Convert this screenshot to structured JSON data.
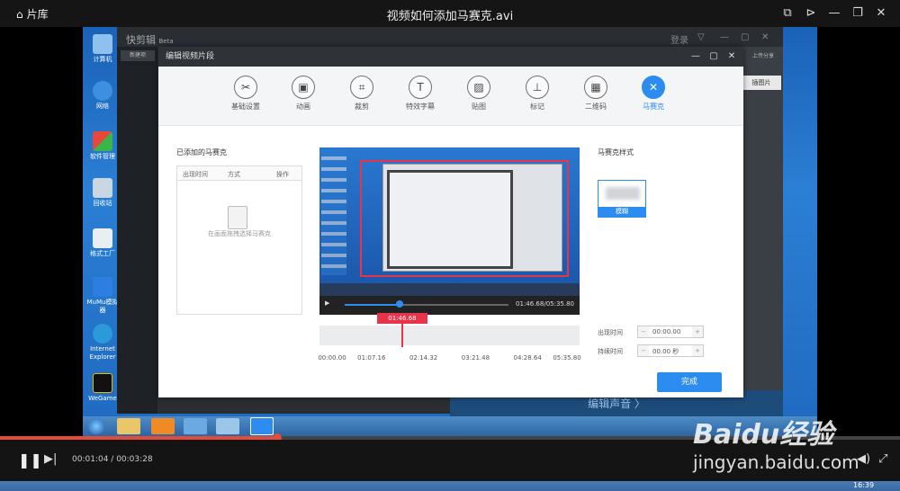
{
  "player": {
    "library_label": "片库",
    "window_title": "视频如何添加马赛克.avi",
    "time_current": "00:01:04",
    "time_total": "00:03:28",
    "progress_fraction": 0.308
  },
  "desktop_icons": [
    "计算机",
    "网络",
    "软件管理",
    "回收站",
    "格式工厂",
    "MuMu模拟器",
    "Internet Explorer",
    "WeGame"
  ],
  "editor_bg": {
    "logo": "快剪辑",
    "beta": "Beta",
    "login": "登录",
    "new": "新建项",
    "upload": "上传分享",
    "image_btn": "插图片",
    "voice_bar": "编辑声音 〉"
  },
  "dialog": {
    "title": "编辑视频片段",
    "tools": [
      {
        "label": "基础设置",
        "glyph": "✂"
      },
      {
        "label": "动画",
        "glyph": "▣"
      },
      {
        "label": "裁剪",
        "glyph": "⌗"
      },
      {
        "label": "特效字幕",
        "glyph": "T"
      },
      {
        "label": "贴图",
        "glyph": "▨"
      },
      {
        "label": "标记",
        "glyph": "⊥"
      },
      {
        "label": "二维码",
        "glyph": "▦"
      },
      {
        "label": "马赛克",
        "glyph": "✕"
      }
    ],
    "added_header": "已添加的马赛克",
    "table_cols": [
      "出现时间",
      "方式",
      "操作"
    ],
    "empty_hint": "在画面拖拽选择马赛克",
    "preview_time": "01:46.68/05:35.80",
    "marker_time": "01:46.68",
    "scale_ticks": [
      "00:00.00",
      "01:07.16",
      "02:14.32",
      "03:21.48",
      "04:28.64",
      "05:35.80"
    ],
    "marker_fraction": 0.318,
    "style_header": "马赛克样式",
    "style_blur": "模糊",
    "appear_label": "出现时间",
    "appear_value": "00:00.00",
    "duration_label": "持续时间",
    "duration_value": "00.00 秒",
    "done_label": "完成"
  },
  "clock": "16:39",
  "watermark": {
    "brand": "Baidu经验",
    "url": "jingyan.baidu.com"
  }
}
